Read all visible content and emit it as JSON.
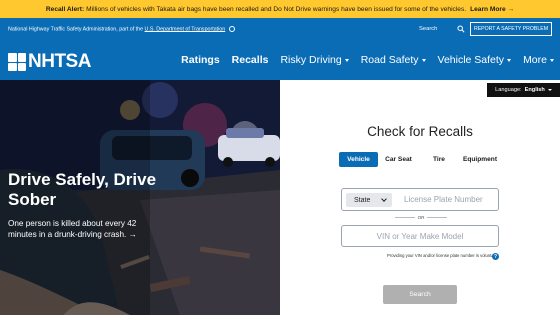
{
  "alert": {
    "label": "Recall Alert:",
    "message": "Millions of vehicles with Takata air bags have been recalled and Do Not Drive warnings have been issued for some of the vehicles.",
    "link": "Learn More →"
  },
  "header": {
    "agency_prefix": "National Highway Traffic Safety Administration, part of the ",
    "agency_link": "U.S. Department of Transportation",
    "search_label": "Search",
    "report_button": "REPORT A SAFETY PROBLEM",
    "logo_text": "NHTSA",
    "nav": [
      {
        "label": "Ratings",
        "dropdown": false
      },
      {
        "label": "Recalls",
        "dropdown": false
      },
      {
        "label": "Risky Driving",
        "dropdown": true
      },
      {
        "label": "Road Safety",
        "dropdown": true
      },
      {
        "label": "Vehicle Safety",
        "dropdown": true
      },
      {
        "label": "More",
        "dropdown": true
      }
    ]
  },
  "hero": {
    "title": "Drive Safely, Drive Sober",
    "subtitle": "One person is killed about every 42 minutes in a drunk-driving crash. →"
  },
  "language": {
    "label": "Language:",
    "value": "English"
  },
  "recall_form": {
    "title": "Check for Recalls",
    "tabs": [
      "Vehicle",
      "Car Seat",
      "Tire",
      "Equipment"
    ],
    "active_tab": "Vehicle",
    "state_select": "State",
    "plate_placeholder": "License Plate Number",
    "or_text": "OR",
    "vin_placeholder": "VIN or Year Make Model",
    "voluntary_note": "Providing your VIN and/or license plate number is voluntary.",
    "help_symbol": "?",
    "search_button": "Search"
  },
  "colors": {
    "alert_bg": "#ffc82e",
    "brand_blue": "#0b6cb6",
    "disabled_button": "#b0b0b0"
  }
}
